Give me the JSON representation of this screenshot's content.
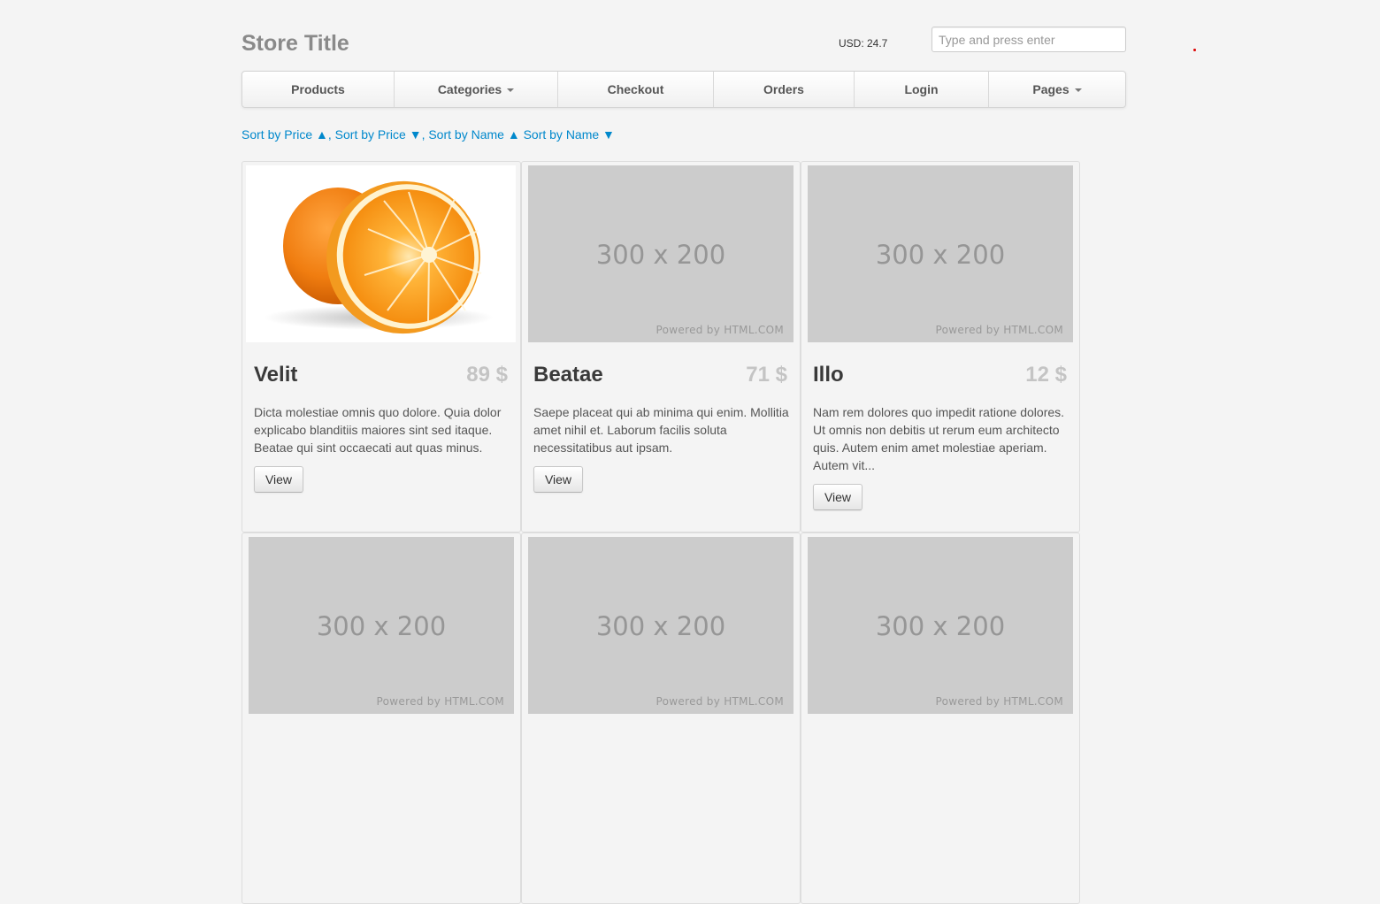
{
  "header": {
    "store_title": "Store Title",
    "currency_label": "USD: 24.7",
    "search_placeholder": "Type and press enter"
  },
  "nav": {
    "items": [
      {
        "label": "Products",
        "dropdown": false
      },
      {
        "label": "Categories",
        "dropdown": true
      },
      {
        "label": "Checkout",
        "dropdown": false
      },
      {
        "label": "Orders",
        "dropdown": false
      },
      {
        "label": "Login",
        "dropdown": false
      },
      {
        "label": "Pages",
        "dropdown": true
      }
    ]
  },
  "sort": {
    "price_asc": "Sort by Price ▲",
    "price_desc": "Sort by Price ▼",
    "name_asc": "Sort by Name ▲",
    "name_desc": "Sort by Name ▼",
    "separator": ","
  },
  "placeholder": {
    "size_text": "300 x 200",
    "powered_text": "Powered by HTML.COM"
  },
  "products": [
    {
      "name": "Velit",
      "price": "89 $",
      "description": "Dicta molestiae omnis quo dolore. Quia dolor explicabo blanditiis maiores sint sed itaque. Beatae qui sint occaecati aut quas minus.",
      "image": "orange-photo",
      "button": "View"
    },
    {
      "name": "Beatae",
      "price": "71 $",
      "description": "Saepe placeat qui ab minima qui enim. Mollitia amet nihil et. Laborum facilis soluta necessitatibus aut ipsam.",
      "image": "placeholder",
      "button": "View"
    },
    {
      "name": "Illo",
      "price": "12 $",
      "description": "Nam rem dolores quo impedit ratione dolores. Ut omnis non debitis ut rerum eum architecto quis. Autem enim amet molestiae aperiam. Autem vit...",
      "image": "placeholder",
      "button": "View"
    },
    {
      "image": "placeholder"
    },
    {
      "image": "placeholder"
    },
    {
      "image": "placeholder"
    }
  ],
  "colors": {
    "background": "#f4f4f4",
    "link": "#0088cc",
    "placeholder_bg": "#cccccc",
    "price": "#c4c4c4"
  }
}
